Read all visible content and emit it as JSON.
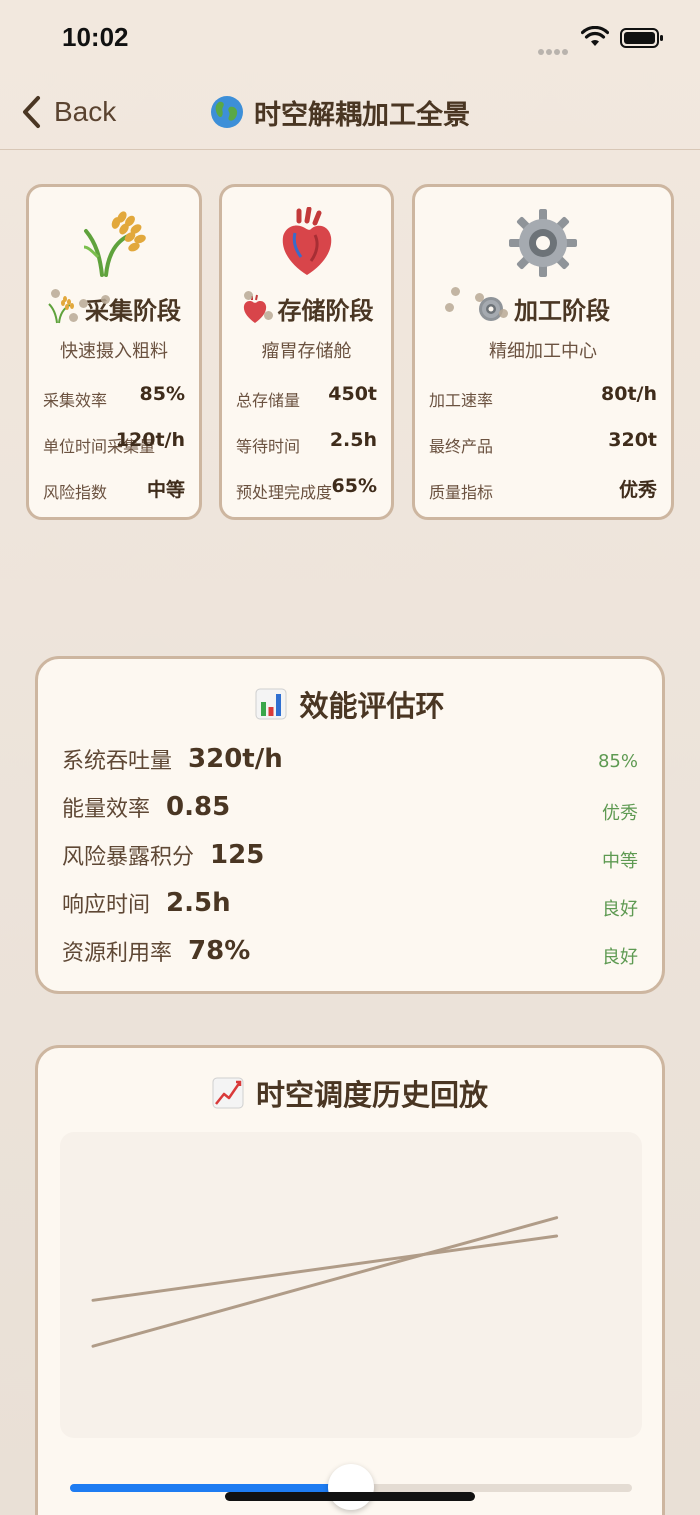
{
  "status_bar": {
    "time": "10:02"
  },
  "nav": {
    "back_label": "Back",
    "title": "时空解耦加工全景"
  },
  "stages": [
    {
      "title": "采集阶段",
      "subtitle": "快速摄入粗料",
      "icon": "rice-icon",
      "metrics": [
        {
          "label": "采集效率",
          "value": "85%"
        },
        {
          "label": "单位时间采集量",
          "value": "120t/h"
        },
        {
          "label": "风险指数",
          "value": "中等"
        }
      ]
    },
    {
      "title": "存储阶段",
      "subtitle": "瘤胃存储舱",
      "icon": "heart-icon",
      "metrics": [
        {
          "label": "总存储量",
          "value": "450t"
        },
        {
          "label": "等待时间",
          "value": "2.5h"
        },
        {
          "label": "预处理完成度",
          "value": "65%"
        }
      ]
    },
    {
      "title": "加工阶段",
      "subtitle": "精细加工中心",
      "icon": "gear-icon",
      "metrics": [
        {
          "label": "加工速率",
          "value": "80t/h"
        },
        {
          "label": "最终产品",
          "value": "320t"
        },
        {
          "label": "质量指标",
          "value": "优秀"
        }
      ]
    }
  ],
  "evaluation": {
    "title": "效能评估环",
    "icon": "bar-chart-icon",
    "rows": [
      {
        "label": "系统吞吐量",
        "value": "320t/h",
        "status": "85%"
      },
      {
        "label": "能量效率",
        "value": "0.85",
        "status": "优秀"
      },
      {
        "label": "风险暴露积分",
        "value": "125",
        "status": "中等"
      },
      {
        "label": "响应时间",
        "value": "2.5h",
        "status": "良好"
      },
      {
        "label": "资源利用率",
        "value": "78%",
        "status": "良好"
      }
    ],
    "status_color": "#5e9a52"
  },
  "history": {
    "title": "时空调度历史回放",
    "icon": "trend-chart-icon",
    "slider_fraction": 0.5,
    "slider_color": "#1e7cf2"
  },
  "chart_data": {
    "type": "line",
    "x": [
      0,
      1
    ],
    "series": [
      {
        "values": [
          0.3,
          0.72
        ]
      },
      {
        "values": [
          0.45,
          0.66
        ]
      }
    ],
    "line_color": "#b09c88",
    "ylim": [
      0,
      1
    ],
    "xlim": [
      0,
      1.1
    ]
  },
  "colors": {
    "card_border": "#cdb6a0",
    "card_bg": "#fdf8f1",
    "text": "#4a3623"
  }
}
